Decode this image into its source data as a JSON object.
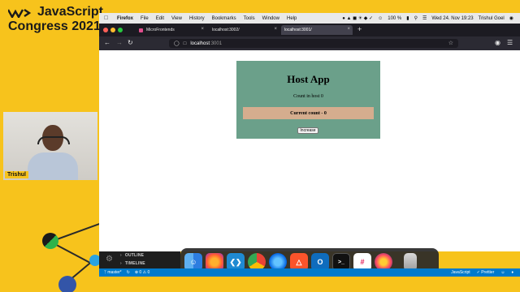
{
  "brand": {
    "line1": "JavaScript",
    "line2": "Congress 2021"
  },
  "presenter": {
    "name": "Trishul"
  },
  "menubar": {
    "apple_icon": "apple-icon",
    "items": [
      "Firefox",
      "File",
      "Edit",
      "View",
      "History",
      "Bookmarks",
      "Tools",
      "Window",
      "Help"
    ],
    "battery": "100 %",
    "datetime": "Wed 24. Nov  19:23",
    "user": "Trishul Goel"
  },
  "browser": {
    "tabs": [
      {
        "label": "MicroFrontends",
        "active": false
      },
      {
        "label": "localhost:3002/",
        "active": false
      },
      {
        "label": "localhost:3001/",
        "active": true
      }
    ],
    "url_host": "localhost",
    "url_port": ":3001"
  },
  "page": {
    "title": "Host App",
    "count_text": "Count in host 0",
    "current_count": "Current count - 0",
    "increase_label": "Increase"
  },
  "vscode": {
    "outline_label": "OUTLINE",
    "timeline_label": "TIMELINE",
    "branch": "master*",
    "problems": "⊗ 0 ⚠ 0",
    "language": "JavaScript",
    "formatter": "✓ Prettier"
  },
  "dock": {
    "apps": [
      "finder-icon",
      "firefox-icon",
      "vscode-icon",
      "chrome-icon",
      "firefox-dev-icon",
      "brave-icon",
      "outlook-icon",
      "terminal-icon",
      "slack-icon",
      "firefox-nightly-icon",
      "trash-icon"
    ]
  },
  "colors": {
    "background": "#f7c31c",
    "host_app_bg": "#6ba08a",
    "current_count_bg": "#d5ad8e",
    "statusbar": "#007acc"
  }
}
